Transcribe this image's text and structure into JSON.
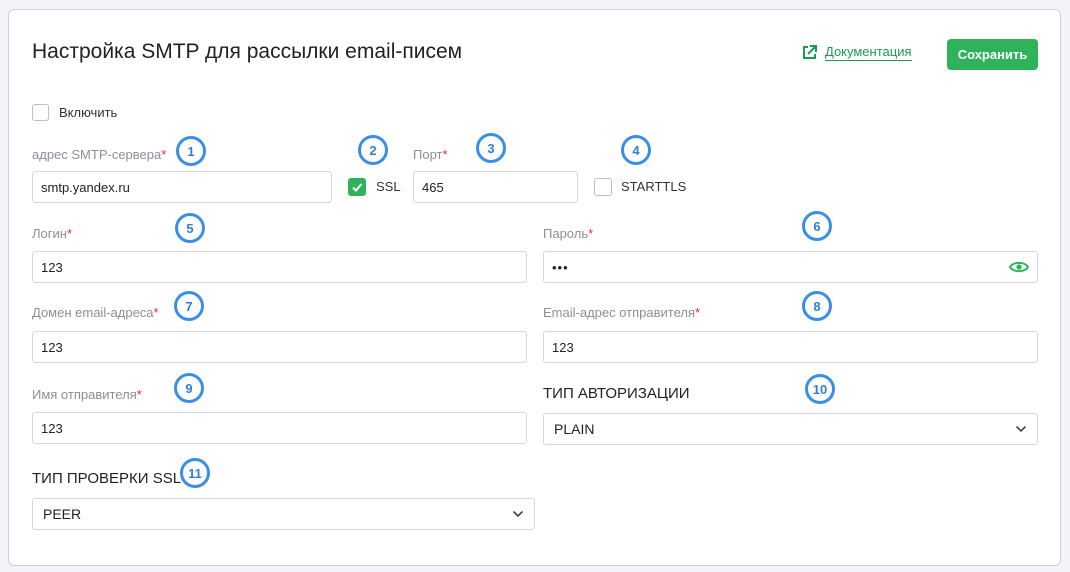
{
  "header": {
    "title": "Настройка SMTP для рассылки email-писем",
    "doc_link": "Документация",
    "save_label": "Сохранить"
  },
  "enable": {
    "label": "Включить",
    "checked": false
  },
  "smtp_server": {
    "label": "адрес SMTP-сервера",
    "required_mark": "*",
    "value": "smtp.yandex.ru"
  },
  "ssl": {
    "label": "SSL",
    "checked": true
  },
  "port": {
    "label": "Порт",
    "required_mark": "*",
    "value": "465"
  },
  "starttls": {
    "label": "STARTTLS",
    "checked": false
  },
  "login": {
    "label": "Логин",
    "required_mark": "*",
    "value": "123"
  },
  "password": {
    "label": "Пароль",
    "required_mark": "*",
    "value": "•••"
  },
  "email_domain": {
    "label": "Домен email-адреса",
    "required_mark": "*",
    "value": "123"
  },
  "sender_email": {
    "label": "Email-адрес отправителя",
    "required_mark": "*",
    "value": "123"
  },
  "sender_name": {
    "label": "Имя отправителя",
    "required_mark": "*",
    "value": "123"
  },
  "auth_type": {
    "label": "ТИП АВТОРИЗАЦИИ",
    "value": "PLAIN"
  },
  "ssl_verify": {
    "label": "ТИП ПРОВЕРКИ SSL",
    "value": "PEER"
  },
  "badges": [
    "1",
    "2",
    "3",
    "4",
    "5",
    "6",
    "7",
    "8",
    "9",
    "10",
    "11"
  ],
  "colors": {
    "accent_green": "#2eb35a",
    "badge_blue": "#3b8ee8",
    "required_red": "#d32f4a"
  },
  "icons": {
    "doc_link": "external-link-icon",
    "checkmark": "checkmark-icon",
    "password_toggle": "eye-icon",
    "dropdown": "chevron-down-icon"
  }
}
